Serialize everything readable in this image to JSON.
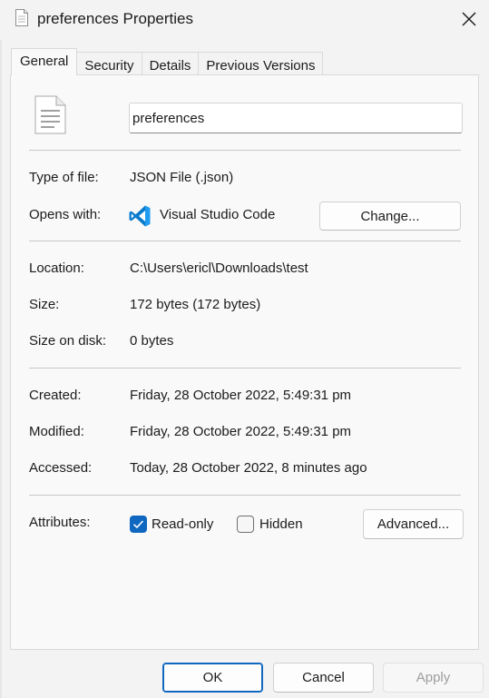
{
  "window": {
    "title": "preferences Properties",
    "title_icon": "document-icon",
    "close_icon": "close-icon"
  },
  "tabs": [
    {
      "label": "General",
      "active": true
    },
    {
      "label": "Security",
      "active": false
    },
    {
      "label": "Details",
      "active": false
    },
    {
      "label": "Previous Versions",
      "active": false
    }
  ],
  "general": {
    "file_name": "preferences",
    "type_of_file": {
      "label": "Type of file:",
      "value": "JSON File (.json)"
    },
    "opens_with": {
      "label": "Opens with:",
      "app_name": "Visual Studio Code",
      "app_icon": "vscode-icon",
      "change_label": "Change..."
    },
    "location": {
      "label": "Location:",
      "value": "C:\\Users\\ericl\\Downloads\\test"
    },
    "size": {
      "label": "Size:",
      "value": "172 bytes (172 bytes)"
    },
    "size_on_disk": {
      "label": "Size on disk:",
      "value": "0 bytes"
    },
    "created": {
      "label": "Created:",
      "value": "Friday, 28 October 2022, 5:49:31 pm"
    },
    "modified": {
      "label": "Modified:",
      "value": "Friday, 28 October 2022, 5:49:31 pm"
    },
    "accessed": {
      "label": "Accessed:",
      "value": "Today, 28 October 2022, 8 minutes ago"
    },
    "attributes": {
      "label": "Attributes:",
      "read_only": {
        "label": "Read-only",
        "checked": true
      },
      "hidden": {
        "label": "Hidden",
        "checked": false
      },
      "advanced_label": "Advanced..."
    }
  },
  "footer": {
    "ok_label": "OK",
    "cancel_label": "Cancel",
    "apply_label": "Apply",
    "apply_enabled": false
  },
  "colors": {
    "accent": "#0f67c0",
    "vscode_blue": "#0a7acc"
  }
}
